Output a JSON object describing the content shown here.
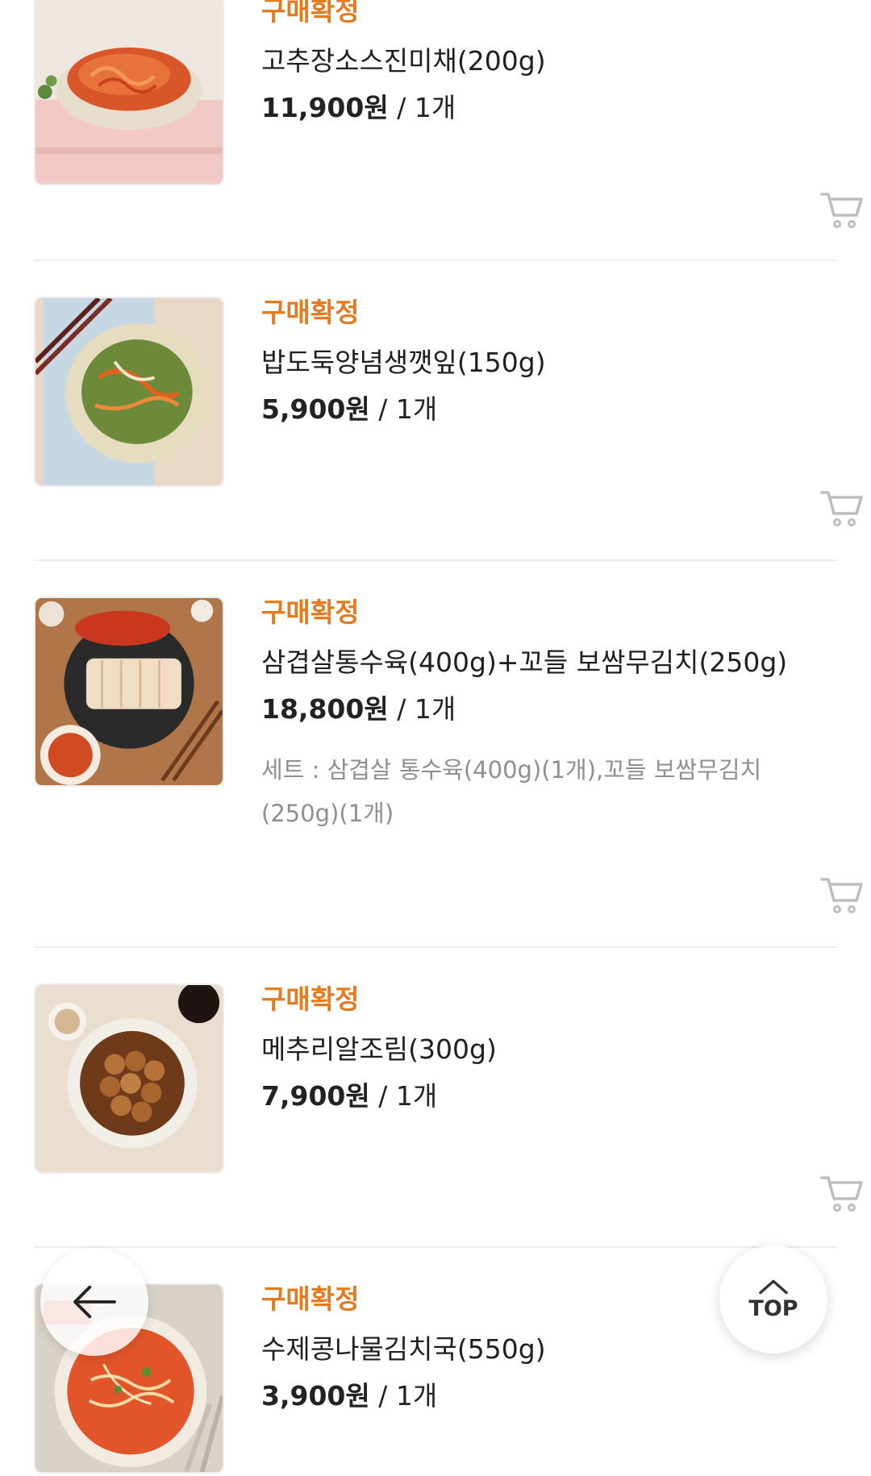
{
  "orders": [
    {
      "status": "구매확정",
      "name": "고추장소스진미채(200g)",
      "price": "11,900원",
      "qty": "/ 1개",
      "thumb_icon": "spicy-squid-dish-image"
    },
    {
      "status": "구매확정",
      "name": "밥도둑양념생깻잎(150g)",
      "price": "5,900원",
      "qty": "/ 1개",
      "thumb_icon": "perilla-leaves-dish-image"
    },
    {
      "status": "구매확정",
      "name": "삼겹살통수육(400g)+꼬들 보쌈무김치(250g)",
      "price": "18,800원",
      "qty": "/ 1개",
      "set_line1": "세트 : 삼겹살 통수육(400g)(1개),꼬들 보쌈무김치",
      "set_line2": "(250g)(1개)",
      "thumb_icon": "bossam-pork-dish-image"
    },
    {
      "status": "구매확정",
      "name": "메추리알조림(300g)",
      "price": "7,900원",
      "qty": "/ 1개",
      "thumb_icon": "braised-quail-eggs-image"
    },
    {
      "status": "구매확정",
      "name": "수제콩나물김치국(550g)",
      "price": "3,900원",
      "qty": "/ 1개",
      "thumb_icon": "bean-sprout-kimchi-soup-image"
    }
  ],
  "fab": {
    "back_icon": "arrow-left-icon",
    "top_label": "TOP",
    "top_icon": "chevron-up-icon"
  },
  "colors": {
    "status": "#e57a1e",
    "divider": "#eeeeee",
    "secondary_text": "#8f8f8f"
  }
}
